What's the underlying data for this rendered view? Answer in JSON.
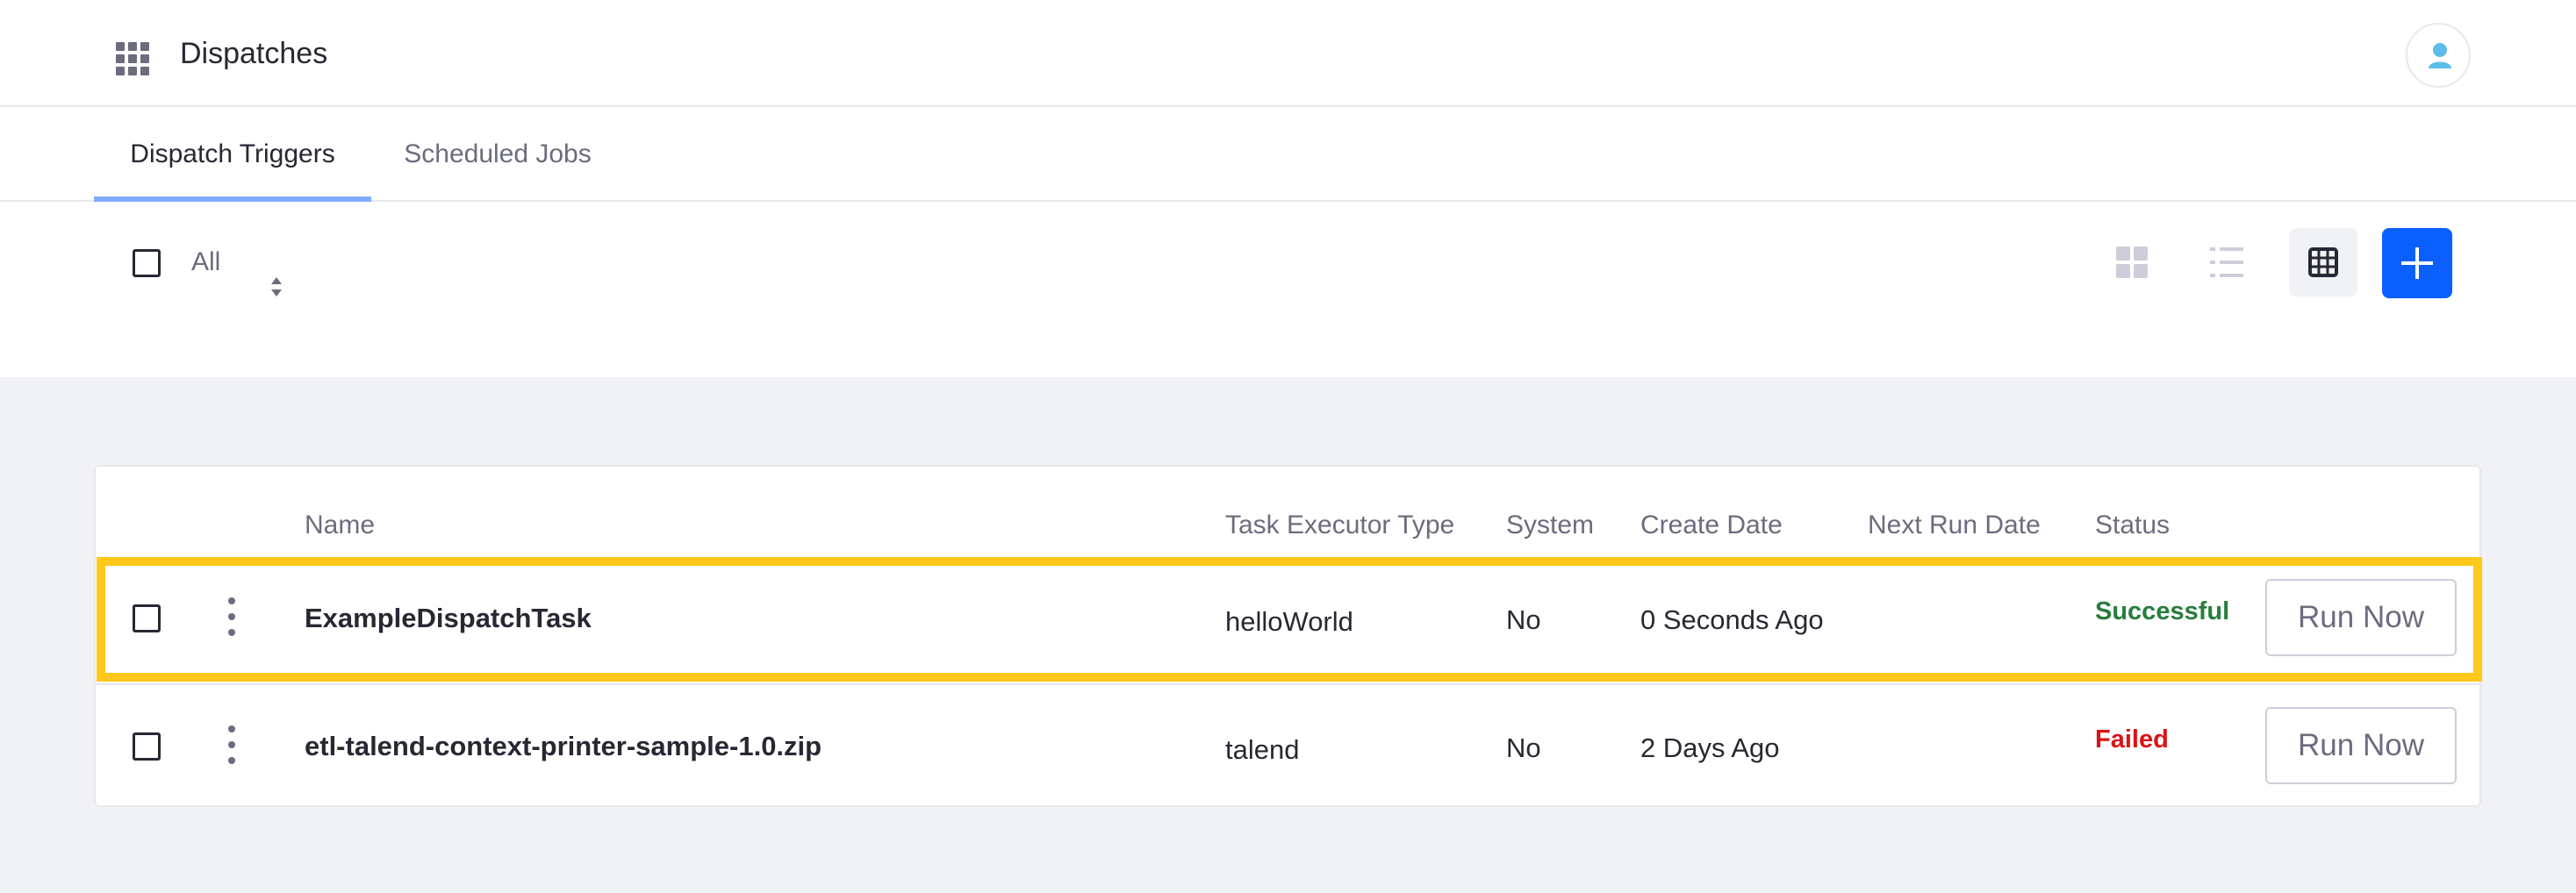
{
  "header": {
    "app_title": "Dispatches",
    "apps_icon": "apps-grid-icon",
    "avatar_icon": "user-icon"
  },
  "tabs": [
    {
      "label": "Dispatch Triggers",
      "active": true
    },
    {
      "label": "Scheduled Jobs",
      "active": false
    }
  ],
  "toolbar": {
    "select_all_label": "All",
    "views": [
      "cards-view-icon",
      "list-view-icon",
      "table-view-icon"
    ],
    "active_view": "table",
    "add_icon": "plus-icon"
  },
  "table": {
    "columns": [
      "Name",
      "Task Executor Type",
      "System",
      "Create Date",
      "Next Run Date",
      "Status"
    ],
    "rows": [
      {
        "name": "ExampleDispatchTask",
        "executor": "helloWorld",
        "system": "No",
        "create_date": "0 Seconds Ago",
        "next_run_date": "",
        "status": "Successful",
        "status_color": "#287d3c",
        "action": "Run Now",
        "highlighted": true
      },
      {
        "name": "etl-talend-context-printer-sample-1.0.zip",
        "executor": "talend",
        "system": "No",
        "create_date": "2 Days Ago",
        "next_run_date": "",
        "status": "Failed",
        "status_color": "#da1414",
        "action": "Run Now",
        "highlighted": false
      }
    ]
  },
  "colors": {
    "primary": "#0b5fff",
    "highlight": "#ffc81a",
    "success": "#287d3c",
    "danger": "#da1414",
    "tab_indicator": "#80acff"
  }
}
